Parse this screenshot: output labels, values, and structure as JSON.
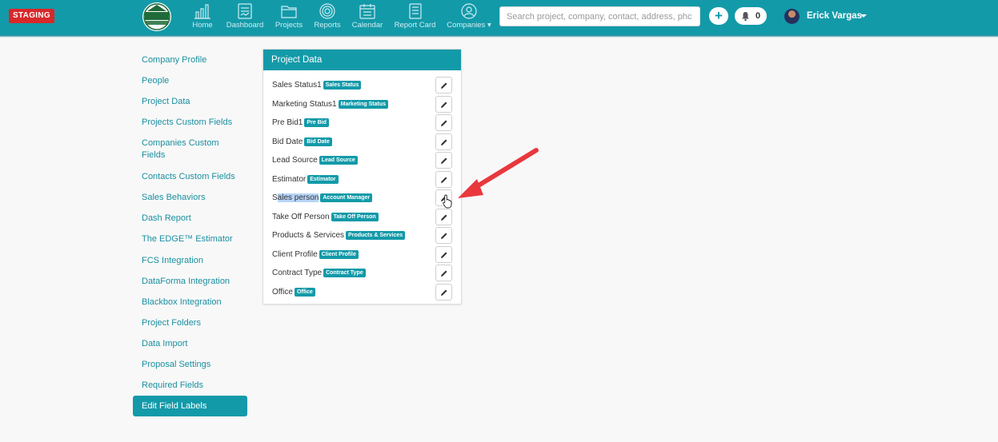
{
  "app": {
    "env_badge": "STAGING",
    "logo_text": "ELK",
    "logo_subtext": "ROOFING SOLUTIONS"
  },
  "nav": [
    {
      "label": "Home",
      "icon": "bar-chart-icon"
    },
    {
      "label": "Dashboard",
      "icon": "dashboard-icon"
    },
    {
      "label": "Projects",
      "icon": "folder-icon"
    },
    {
      "label": "Reports",
      "icon": "target-icon"
    },
    {
      "label": "Calendar",
      "icon": "calendar-icon"
    },
    {
      "label": "Report Card",
      "icon": "report-card-icon"
    },
    {
      "label": "Companies",
      "icon": "user-circle-icon"
    }
  ],
  "search": {
    "placeholder": "Search project, company, contact, address, phc"
  },
  "notifications": {
    "count": "0"
  },
  "user": {
    "name": "Erick Vargas"
  },
  "sidebar": {
    "items": [
      {
        "label": "Company Profile"
      },
      {
        "label": "People"
      },
      {
        "label": "Project Data"
      },
      {
        "label": "Projects Custom Fields"
      },
      {
        "label": "Companies Custom Fields"
      },
      {
        "label": "Contacts Custom Fields"
      },
      {
        "label": "Sales Behaviors"
      },
      {
        "label": "Dash Report"
      },
      {
        "label": "The EDGE™ Estimator"
      },
      {
        "label": "FCS Integration"
      },
      {
        "label": "DataForma Integration"
      },
      {
        "label": "Blackbox Integration"
      },
      {
        "label": "Project Folders"
      },
      {
        "label": "Data Import"
      },
      {
        "label": "Proposal Settings"
      },
      {
        "label": "Required Fields"
      },
      {
        "label": "Edit Field Labels"
      }
    ],
    "active": "Edit Field Labels"
  },
  "card": {
    "title": "Project Data",
    "rows": [
      {
        "label": "Sales Status1",
        "badge": "Sales Status"
      },
      {
        "label": "Marketing Status1",
        "badge": "Marketing Status"
      },
      {
        "label": "Pre Bid1",
        "badge": "Pre Bid"
      },
      {
        "label": "Bid Date",
        "badge": "Bid Date"
      },
      {
        "label": "Lead Source",
        "badge": "Lead Source"
      },
      {
        "label": "Estimator",
        "badge": "Estimator"
      },
      {
        "label_pre": "S",
        "label_hl": "ales person",
        "badge": "Account Manager"
      },
      {
        "label": "Take Off Person",
        "badge": "Take Off Person"
      },
      {
        "label": "Products & Services",
        "badge": "Products & Services"
      },
      {
        "label": "Client Profile",
        "badge": "Client Profile"
      },
      {
        "label": "Contract Type",
        "badge": "Contract Type"
      },
      {
        "label": "Office",
        "badge": "Office"
      }
    ]
  },
  "colors": {
    "brand": "#139aa9",
    "staging": "#d8282a",
    "annotation_arrow": "#e8383d"
  }
}
